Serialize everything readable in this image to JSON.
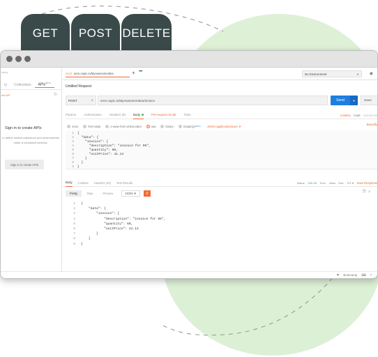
{
  "method_pills": [
    "GET",
    "POST",
    "DELETE"
  ],
  "colors": {
    "accent": "#ef6c35",
    "send": "#1d7ee0",
    "pill_bg": "#3a4a4a",
    "blob": "#d8eed0",
    "ok": "#47a24f"
  },
  "sidebar": {
    "history_stub": "istory",
    "tabs": [
      {
        "label": "ry",
        "active": false
      },
      {
        "label": "Collections",
        "active": false
      },
      {
        "label": "APIs",
        "badge": "BETA",
        "active": true
      }
    ],
    "new_api": "ew API",
    "signin_title": "Sign in to create APIs",
    "signin_text": "ro define related collections and environments under a consistent schema.",
    "signin_button": "Sign in to create APIs"
  },
  "header": {
    "request_tab": {
      "method": "POST",
      "label": "eren.capic.io/MyAwesomeIdea"
    },
    "new_tab_icon": "plus-icon",
    "more_tabs": "•••",
    "environment": "No Environment",
    "request_title": "Untitled Request"
  },
  "url_bar": {
    "method": "POST",
    "url": "eren.capic.io/MyAwesomeIdea/invoice",
    "send_label": "Send",
    "save_label": "Save"
  },
  "request_tabs": [
    {
      "label": "Params"
    },
    {
      "label": "Authorization"
    },
    {
      "label": "Headers (8)"
    },
    {
      "label": "Body",
      "active": true,
      "dot": true
    },
    {
      "label": "Pre-request Script",
      "highlight": true
    },
    {
      "label": "Tests"
    }
  ],
  "request_links": {
    "cookies": "Cookies",
    "code": "Code",
    "comments": "Comments"
  },
  "body_types": [
    {
      "label": "none"
    },
    {
      "label": "form-data"
    },
    {
      "label": "x-www-form-urlencoded"
    },
    {
      "label": "raw",
      "selected": true
    },
    {
      "label": "binary"
    },
    {
      "label": "GraphQL",
      "badge": "BETA"
    }
  ],
  "content_type": "JSON (application/json)",
  "beautify": "Beautify",
  "request_body_lines": [
    {
      "n": "1",
      "text": "{"
    },
    {
      "n": "2",
      "text": "  \"data\": {"
    },
    {
      "n": "3",
      "text": "    \"invoice\": {"
    },
    {
      "n": "4",
      "text": "      \"description\": \"invoice for 95\","
    },
    {
      "n": "5",
      "text": "      \"quantity\": 60,"
    },
    {
      "n": "6",
      "text": "      \"unitPrice\": 41.14"
    },
    {
      "n": "7",
      "text": "    }"
    },
    {
      "n": "8",
      "text": "  }"
    },
    {
      "n": "9",
      "text": "}"
    }
  ],
  "response_tabs": [
    {
      "label": "Body",
      "active": true
    },
    {
      "label": "Cookies"
    },
    {
      "label": "Headers (20)"
    },
    {
      "label": "Test Results"
    }
  ],
  "response_stats": {
    "status_label": "Status:",
    "status": "200 OK",
    "time_label": "Time:",
    "time": "44ms",
    "size_label": "Size:",
    "size": "371 B",
    "save": "Save Response"
  },
  "response_views": [
    {
      "label": "Pretty",
      "active": true
    },
    {
      "label": "Raw"
    },
    {
      "label": "Preview"
    }
  ],
  "response_format": "JSON",
  "response_body_lines": [
    {
      "n": "1",
      "text": "{"
    },
    {
      "n": "2",
      "text": "    \"data\": {"
    },
    {
      "n": "3",
      "text": "        \"invoice\": {"
    },
    {
      "n": "4",
      "text": "            \"description\": \"invoice for 95\","
    },
    {
      "n": "5",
      "text": "            \"quantity\": 60,"
    },
    {
      "n": "6",
      "text": "            \"unitPrice\": 41.14"
    },
    {
      "n": "7",
      "text": "        }"
    },
    {
      "n": "8",
      "text": "    }"
    },
    {
      "n": "9",
      "text": "}"
    }
  ],
  "statusbar": {
    "bootcamp": "Bootcamp"
  }
}
